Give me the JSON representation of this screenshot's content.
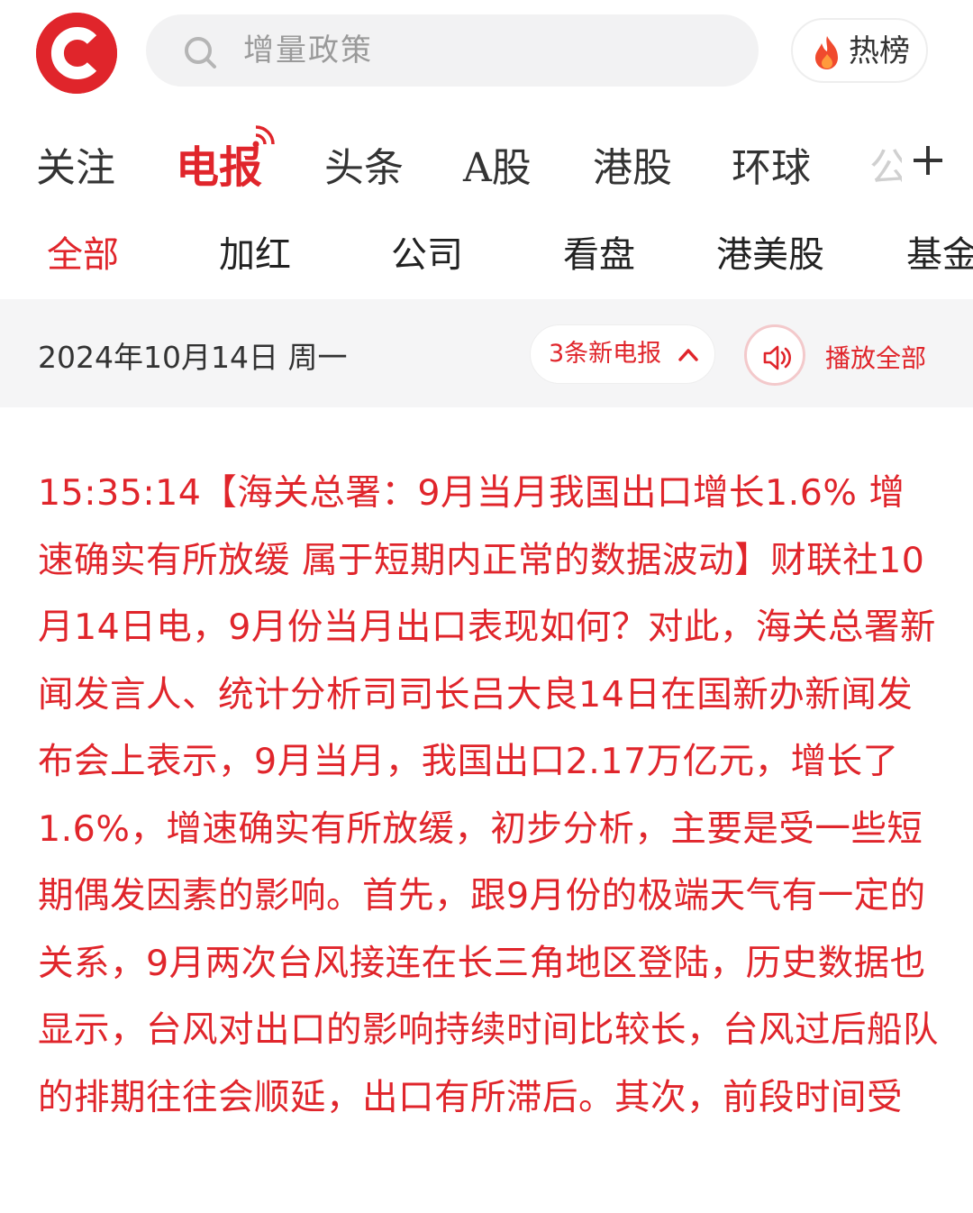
{
  "header": {
    "search_placeholder": "增量政策",
    "hot_label": "热榜"
  },
  "channels": [
    "关注",
    "电报",
    "头条",
    "A股",
    "港股",
    "环球",
    "公"
  ],
  "subtabs": [
    "全部",
    "加红",
    "公司",
    "看盘",
    "港美股",
    "基金"
  ],
  "date_bar": {
    "date": "2024年10月14日 周一",
    "new_count_label": "3条新电报",
    "play_all_label": "播放全部"
  },
  "article": {
    "time": "15:35:14",
    "headline": "【海关总署：9月当月我国出口增长1.6% 增速确实有所放缓 属于短期内正常的数据波动】",
    "body": "财联社10月14日电，9月份当月出口表现如何？对此，海关总署新闻发言人、统计分析司司长吕大良14日在国新办新闻发布会上表示，9月当月，我国出口2.17万亿元，增长了1.6%，增速确实有所放缓，初步分析，主要是受一些短期偶发因素的影响。首先，跟9月份的极端天气有一定的关系，9月两次台风接连在长三角地区登陆，历史数据也显示，台风对出口的影响持续时间比较长，台风过后船队的排期往往会顺延，出口有所滞后。其次，前段时间受"
  },
  "colors": {
    "accent": "#e0252b",
    "date_bar_bg": "#f5f5f6",
    "search_bg": "#f2f2f3"
  }
}
